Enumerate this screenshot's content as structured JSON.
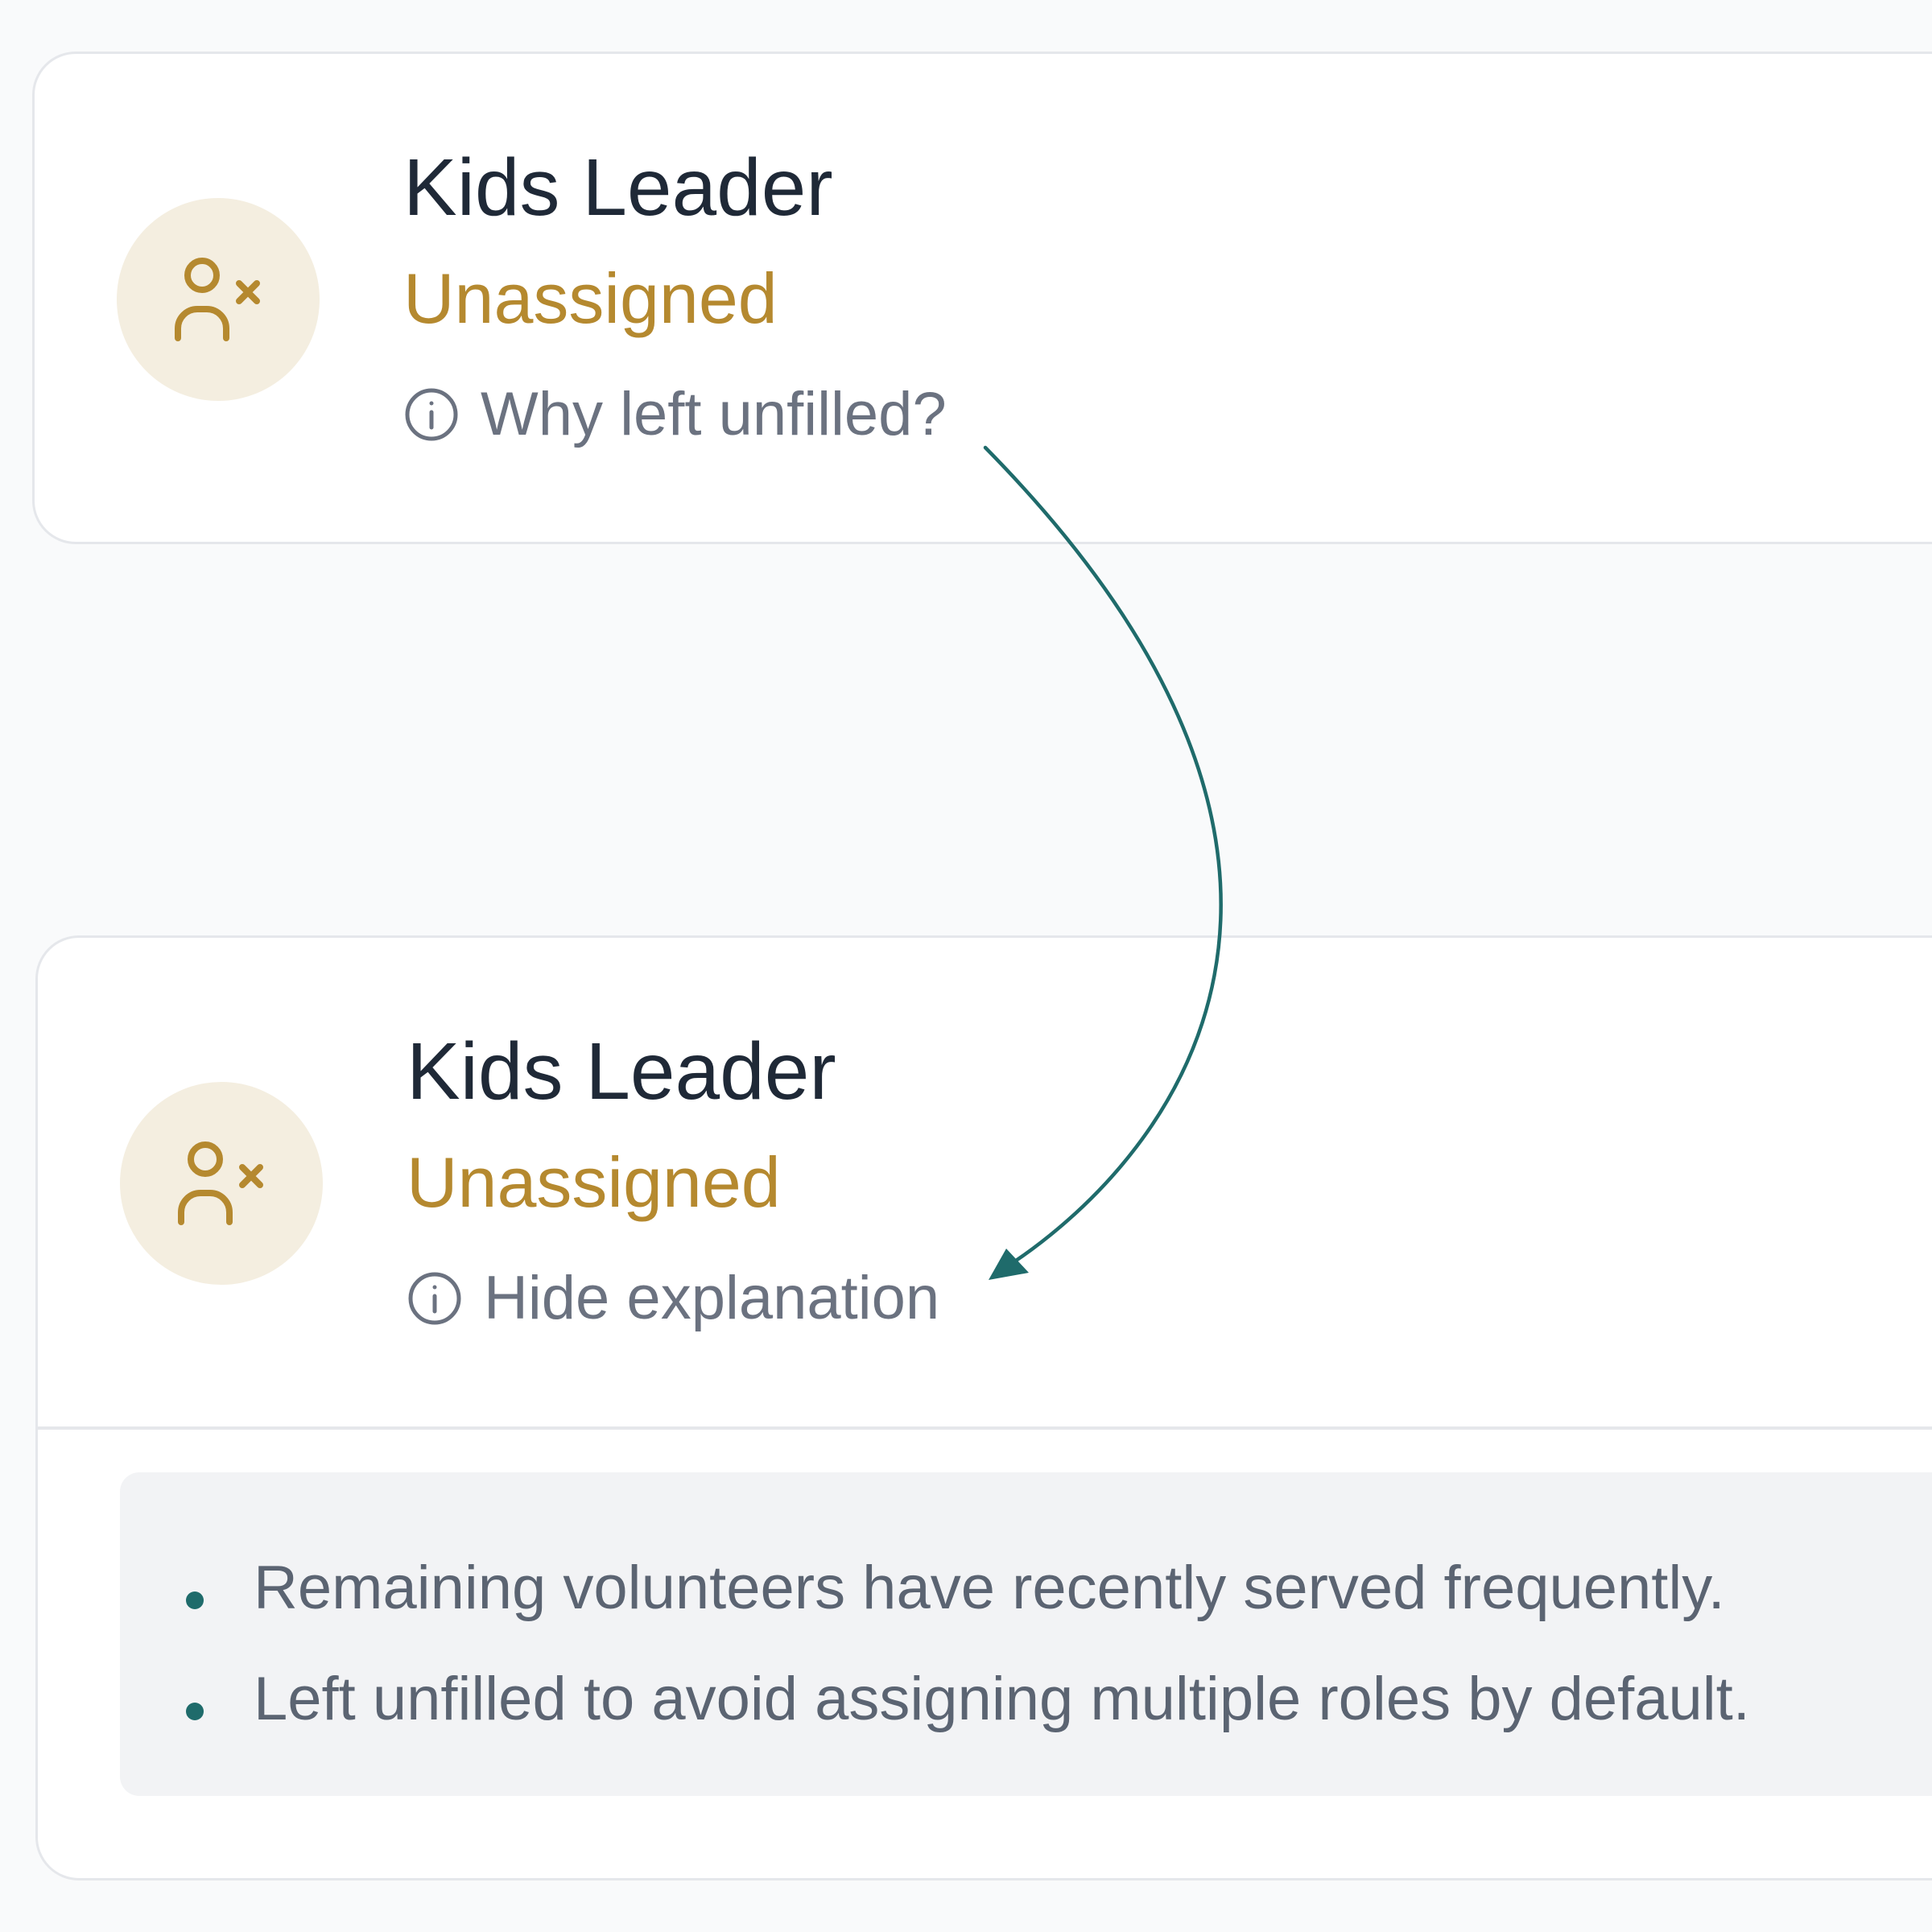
{
  "cards": [
    {
      "state": "collapsed",
      "avatar_icon": "user-x-icon",
      "role_title": "Kids Leader",
      "status": "Unassigned",
      "toggle_icon": "info-icon",
      "toggle_label": "Why left unfilled?"
    },
    {
      "state": "expanded",
      "avatar_icon": "user-x-icon",
      "role_title": "Kids Leader",
      "status": "Unassigned",
      "toggle_icon": "info-icon",
      "toggle_label": "Hide explanation",
      "reasons": [
        "Remaining volunteers have recently served frequently.",
        "Left unfilled to avoid assigning multiple roles by default."
      ]
    }
  ],
  "colors": {
    "status_gold": "#b5892f",
    "avatar_bg": "#f4eee0",
    "title": "#1f2937",
    "muted_text": "#6b7280",
    "accent_teal": "#1f6b6b",
    "explanation_bg": "#f2f3f5",
    "border": "#e5e7eb"
  }
}
